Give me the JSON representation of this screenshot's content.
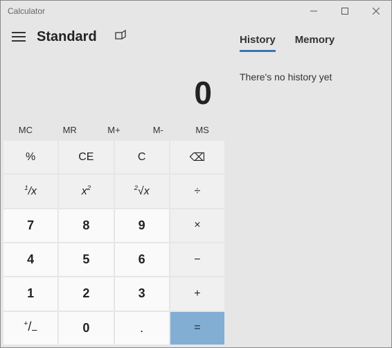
{
  "window": {
    "title": "Calculator"
  },
  "header": {
    "mode": "Standard"
  },
  "display": {
    "value": "0"
  },
  "memory": {
    "mc": "MC",
    "mr": "MR",
    "mplus": "M+",
    "mminus": "M-",
    "ms": "MS"
  },
  "keys": {
    "percent": "%",
    "ce": "CE",
    "c": "C",
    "backspace": "⌫",
    "reciprocal": "¹⁄ₓ",
    "square": "x²",
    "root": "²√x",
    "divide": "÷",
    "7": "7",
    "8": "8",
    "9": "9",
    "multiply": "×",
    "4": "4",
    "5": "5",
    "6": "6",
    "minus": "−",
    "1": "1",
    "2": "2",
    "3": "3",
    "plus": "+",
    "negate": "⁺⁄₋",
    "0": "0",
    "decimal": ".",
    "equals": "="
  },
  "side": {
    "tabs": {
      "history": "History",
      "memory": "Memory"
    },
    "historyEmpty": "There's no history yet"
  }
}
